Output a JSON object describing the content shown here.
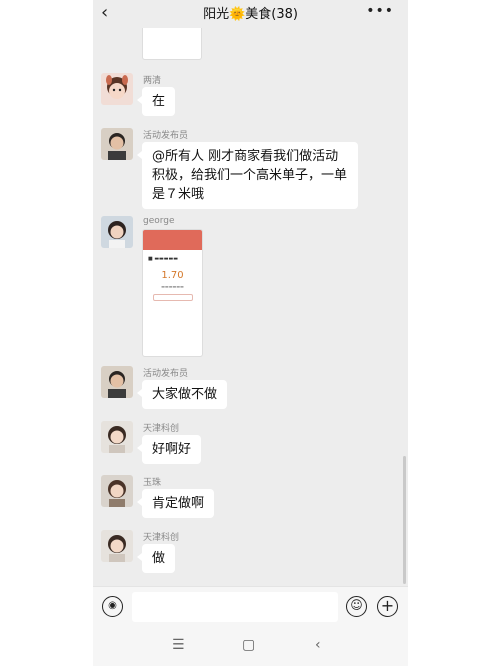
{
  "header": {
    "back_icon": "chevron-left-icon",
    "title": "阳光🌞美食(38)",
    "more_icon": "more-dots-icon"
  },
  "messages": [
    {
      "sender": "两清",
      "text": "在",
      "avatar": "girl-with-bunny-ears-avatar"
    },
    {
      "sender": "活动发布员",
      "text": "@所有人  刚才商家看我们做活动积极，给我们一个高米单子，一单是７米哦",
      "avatar": "man-avatar"
    },
    {
      "sender": "george",
      "type": "image",
      "image": {
        "amount": "1.70"
      },
      "avatar": "woman-avatar"
    },
    {
      "sender": "活动发布员",
      "text": "大家做不做",
      "avatar": "man-avatar"
    },
    {
      "sender": "天津科创",
      "text": "好啊好",
      "avatar": "woman-avatar"
    },
    {
      "sender": "玉珠",
      "text": "肯定做啊",
      "avatar": "woman-avatar"
    },
    {
      "sender": "天津科创",
      "text": "做",
      "avatar": "woman-avatar"
    }
  ],
  "input_bar": {
    "voice_icon": "voice-icon",
    "text_value": "",
    "emoji_icon": "emoji-icon",
    "plus_icon": "plus-icon"
  },
  "nav_bar": {
    "menu_icon": "menu-icon",
    "home_icon": "home-icon",
    "back_icon": "back-icon"
  }
}
